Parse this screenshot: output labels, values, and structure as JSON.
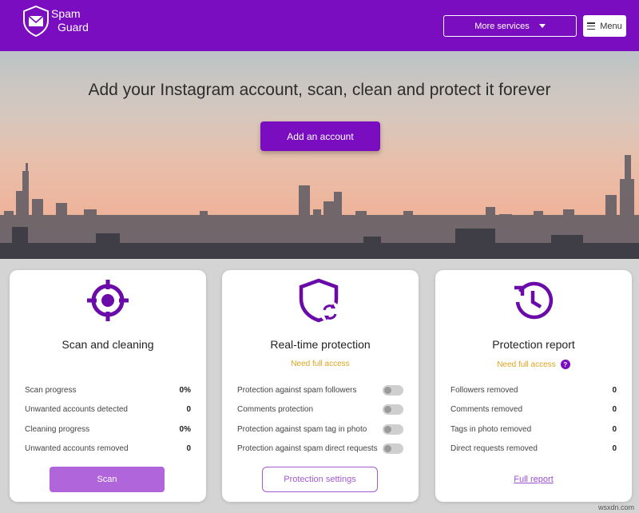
{
  "header": {
    "brand_line1": "Spam",
    "brand_line2": "Guard",
    "more_services_label": "More services",
    "menu_label": "Menu"
  },
  "hero": {
    "title": "Add your Instagram account, scan, clean and protect it forever",
    "add_account_label": "Add an account"
  },
  "cards": {
    "scan": {
      "title": "Scan and cleaning",
      "rows": [
        {
          "label": "Scan progress",
          "value": "0%"
        },
        {
          "label": "Unwanted accounts detected",
          "value": "0"
        },
        {
          "label": "Cleaning progress",
          "value": "0%"
        },
        {
          "label": "Unwanted accounts removed",
          "value": "0"
        }
      ],
      "button_label": "Scan"
    },
    "protection": {
      "title": "Real-time protection",
      "subtitle": "Need full access",
      "rows": [
        {
          "label": "Protection against spam followers"
        },
        {
          "label": "Comments protection"
        },
        {
          "label": "Protection against spam tag in photo"
        },
        {
          "label": "Protection against spam direct requests"
        }
      ],
      "button_label": "Protection settings"
    },
    "report": {
      "title": "Protection report",
      "subtitle": "Need full access",
      "help_glyph": "?",
      "rows": [
        {
          "label": "Followers removed",
          "value": "0"
        },
        {
          "label": "Comments removed",
          "value": "0"
        },
        {
          "label": "Tags in photo removed",
          "value": "0"
        },
        {
          "label": "Direct requests removed",
          "value": "0"
        }
      ],
      "link_label": "Full report"
    }
  },
  "watermark": "wsxdn.com",
  "colors": {
    "brand_purple": "#7a0dbf",
    "button_light_purple": "#b065da",
    "warning_gold": "#e0a41e"
  },
  "icons": [
    "shield-envelope-logo",
    "caret-down-icon",
    "hamburger-icon",
    "crosshair-icon",
    "shield-sync-icon",
    "clock-history-icon",
    "help-icon"
  ]
}
